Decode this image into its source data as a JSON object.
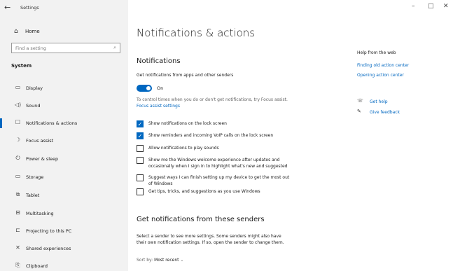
{
  "window": {
    "title": "Settings",
    "back_glyph": "←",
    "controls": {
      "minimize": "–",
      "maximize": "□",
      "close": "✕"
    }
  },
  "sidebar": {
    "home": {
      "label": "Home",
      "icon": "home-icon",
      "glyph": "⌂"
    },
    "search_placeholder": "Find a setting",
    "search_icon_glyph": "⌕",
    "section": "System",
    "items": [
      {
        "label": "Display",
        "icon": "display-icon",
        "glyph": "▭"
      },
      {
        "label": "Sound",
        "icon": "speaker-icon",
        "glyph": "◁)"
      },
      {
        "label": "Notifications & actions",
        "icon": "notifications-icon",
        "glyph": "☐",
        "active": true
      },
      {
        "label": "Focus assist",
        "icon": "moon-icon",
        "glyph": "☽"
      },
      {
        "label": "Power & sleep",
        "icon": "power-icon",
        "glyph": "⏻"
      },
      {
        "label": "Storage",
        "icon": "storage-icon",
        "glyph": "▭"
      },
      {
        "label": "Tablet",
        "icon": "tablet-icon",
        "glyph": "⧉"
      },
      {
        "label": "Multitasking",
        "icon": "multitasking-icon",
        "glyph": "⊟"
      },
      {
        "label": "Projecting to this PC",
        "icon": "projecting-icon",
        "glyph": "⊏"
      },
      {
        "label": "Shared experiences",
        "icon": "shared-icon",
        "glyph": "✕"
      },
      {
        "label": "Clipboard",
        "icon": "clipboard-icon",
        "glyph": "⎘"
      }
    ]
  },
  "main": {
    "title": "Notifications & actions",
    "notifications_header": "Notifications",
    "get_notifications_label": "Get notifications from apps and other senders",
    "toggle_state": "On",
    "focus_note": "To control times when you do or don't get notifications, try Focus assist.",
    "focus_link": "Focus assist settings",
    "checkboxes": [
      {
        "label": "Show notifications on the lock screen",
        "checked": true
      },
      {
        "label": "Show reminders and incoming VoIP calls on the lock screen",
        "checked": true
      },
      {
        "label": "Allow notifications to play sounds",
        "checked": false
      },
      {
        "label_line1": "Show me the Windows welcome experience after updates and",
        "label_line2": "occasionally when I sign in to highlight what's new and suggested",
        "checked": false
      },
      {
        "label_line1": "Suggest ways I can finish setting up my device to get the most out",
        "label_line2": "of Windows",
        "checked": false
      },
      {
        "label": "Get tips, tricks, and suggestions as you use Windows",
        "checked": false
      }
    ],
    "senders_header": "Get notifications from these senders",
    "senders_desc_line1": "Select a sender to see more settings. Some senders might also have",
    "senders_desc_line2": "their own notification settings. If so, open the sender to change them.",
    "sort_label": "Sort by:",
    "sort_value": "Most recent",
    "sort_chevron": "⌄"
  },
  "help": {
    "header": "Help from the web",
    "links": [
      "Finding old action center",
      "Opening action center"
    ],
    "get_help": "Get help",
    "give_feedback": "Give feedback",
    "get_help_glyph": "☏",
    "feedback_glyph": "✎"
  }
}
